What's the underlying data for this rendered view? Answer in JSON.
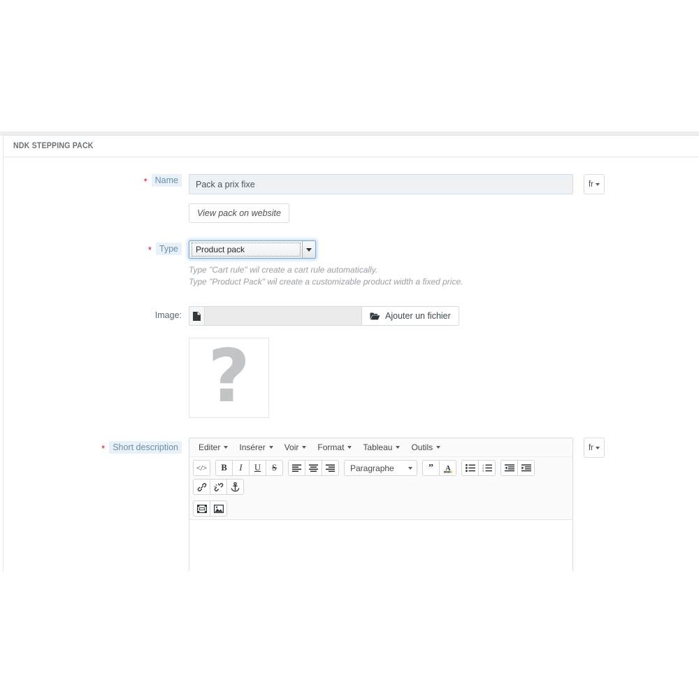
{
  "panel": {
    "title": "NDK STEPPING PACK"
  },
  "fields": {
    "name": {
      "label": "Name",
      "required_marker": "*",
      "value": "Pack a prix fixe",
      "lang": "fr",
      "view_button": "View pack on website"
    },
    "type": {
      "label": "Type",
      "required_marker": "*",
      "selected": "Product pack",
      "options": [
        "Product pack",
        "Cart rule"
      ],
      "helper_line_1": "Type \"Cart rule\" wil create a cart rule automatically.",
      "helper_line_2": "Type \"Product Pack\" wil create a customizable product width a fixed price."
    },
    "image": {
      "label": "Image:",
      "file_value": "",
      "file_placeholder": "",
      "browse_button": "Ajouter un fichier",
      "placeholder_glyph": "?"
    },
    "short_description": {
      "label": "Short description",
      "required_marker": "*",
      "lang": "fr",
      "content": ""
    }
  },
  "editor": {
    "menubar": [
      {
        "label": "Editer"
      },
      {
        "label": "Insérer"
      },
      {
        "label": "Voir"
      },
      {
        "label": "Format"
      },
      {
        "label": "Tableau"
      },
      {
        "label": "Outils"
      }
    ],
    "format_select": "Paragraphe",
    "toolbar_icons": [
      "source-code-icon",
      "bold-icon",
      "italic-icon",
      "underline-icon",
      "strikethrough-icon",
      "align-left-icon",
      "align-center-icon",
      "align-right-icon",
      "blockquote-icon",
      "text-color-icon",
      "bullet-list-icon",
      "numbered-list-icon",
      "outdent-icon",
      "indent-icon",
      "link-icon",
      "unlink-icon",
      "anchor-icon",
      "media-icon",
      "image-icon"
    ]
  },
  "colors": {
    "required": "#e4002b",
    "label_text": "#6b8fa8",
    "label_bg": "#e8f1f7",
    "panel_border": "#dfe3e8",
    "focus_glow": "#78afe1",
    "helper_text": "#9aa1a7",
    "placeholder_grey": "#c2c4c6"
  }
}
